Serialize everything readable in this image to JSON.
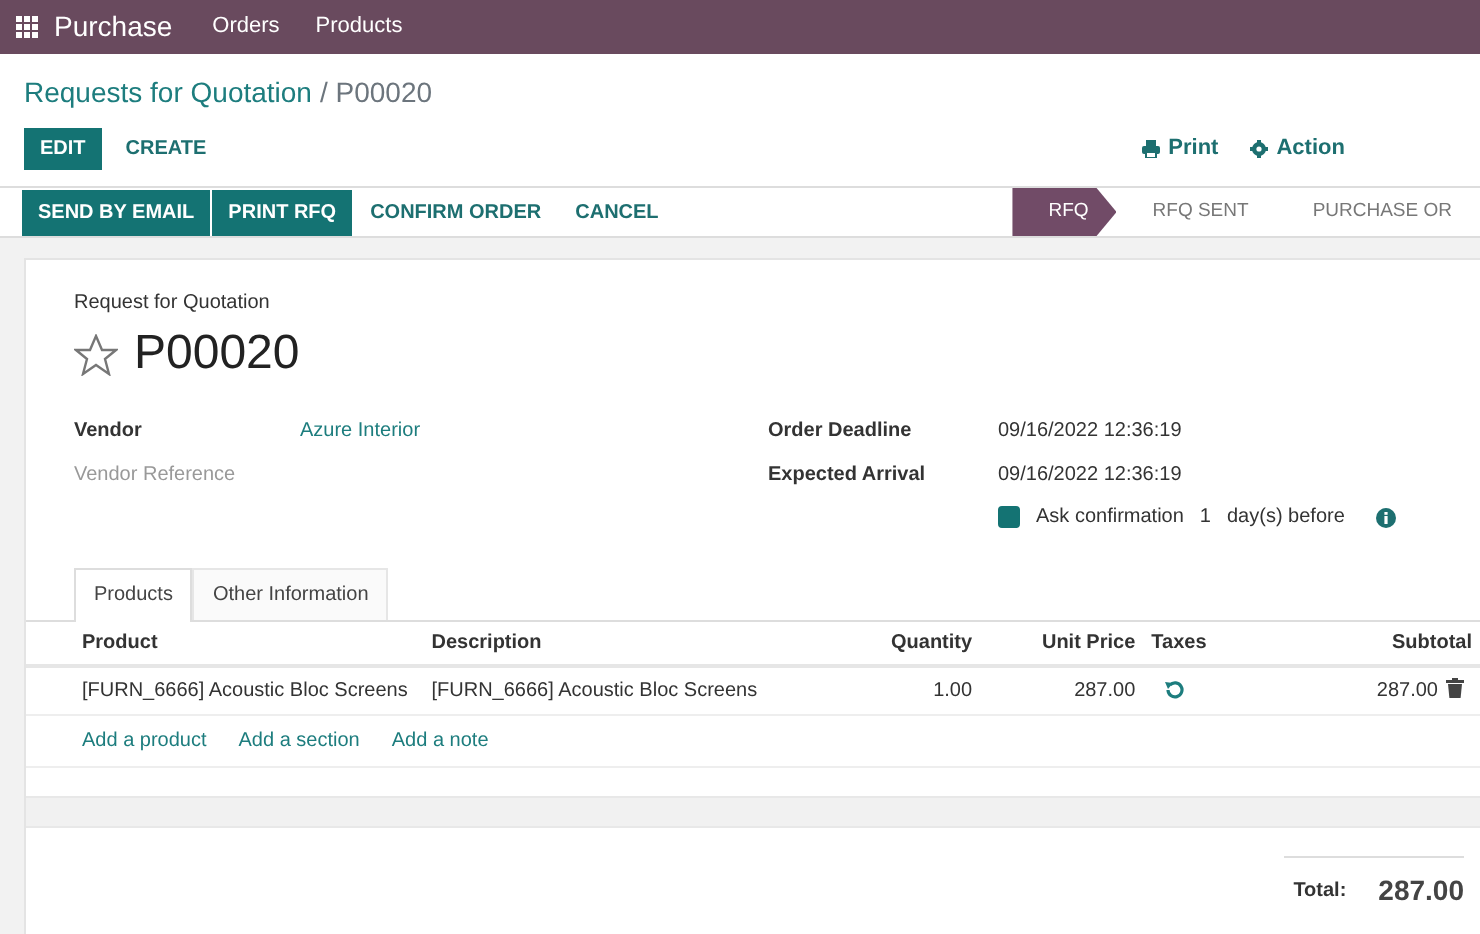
{
  "navbar": {
    "app": "Purchase",
    "menus": [
      "Orders",
      "Products"
    ]
  },
  "breadcrumb": {
    "parent": "Requests for Quotation",
    "current": "/ P00020"
  },
  "control_buttons": [
    {
      "label": "EDIT",
      "primary": true
    },
    {
      "label": "CREATE",
      "primary": false
    }
  ],
  "actions": [
    {
      "kind": "print",
      "label": "Print"
    },
    {
      "kind": "gear",
      "label": "Action"
    }
  ],
  "header_buttons": [
    {
      "label": "SEND BY EMAIL",
      "primary": true
    },
    {
      "label": "PRINT RFQ",
      "primary": true
    },
    {
      "label": "CONFIRM ORDER",
      "primary": false
    },
    {
      "label": "CANCEL",
      "primary": false
    }
  ],
  "statuses": [
    {
      "label": "RFQ",
      "selected": true
    },
    {
      "label": "RFQ SENT",
      "selected": false
    },
    {
      "label": "PURCHASE OR",
      "selected": false
    }
  ],
  "document": {
    "subtitle": "Request for Quotation",
    "name": "P00020",
    "starred": false
  },
  "left_fields": [
    {
      "label": "Vendor",
      "value": "Azure Interior",
      "muted": false
    },
    {
      "label": "Vendor Reference",
      "muted": true
    }
  ],
  "right_fields": [
    {
      "label": "Order Deadline",
      "value": "09/16/2022 12:36:19"
    },
    {
      "label": "Expected Arrival",
      "value": "09/16/2022 12:36:19"
    }
  ],
  "confirmation": {
    "checked": true,
    "text": "Ask confirmation",
    "days": "1",
    "suffix": "day(s) before"
  },
  "tabs": [
    {
      "label": "Products",
      "selected": true
    },
    {
      "label": "Other Information",
      "selected": false
    }
  ],
  "table": {
    "columns": [
      "Product",
      "Description",
      "Quantity",
      "Unit Price",
      "Taxes",
      "Subtotal"
    ],
    "rows": [
      {
        "product": "[FURN_6666] Acoustic Bloc Screens",
        "description": "[FURN_6666] Acoustic Bloc Screens",
        "quantity": "1.00",
        "unit_price": "287.00",
        "taxes": "",
        "subtotal": "287.00"
      }
    ],
    "add_links": [
      "Add a product",
      "Add a section",
      "Add a note"
    ]
  },
  "total": {
    "label": "Total:",
    "value": "287.00"
  }
}
